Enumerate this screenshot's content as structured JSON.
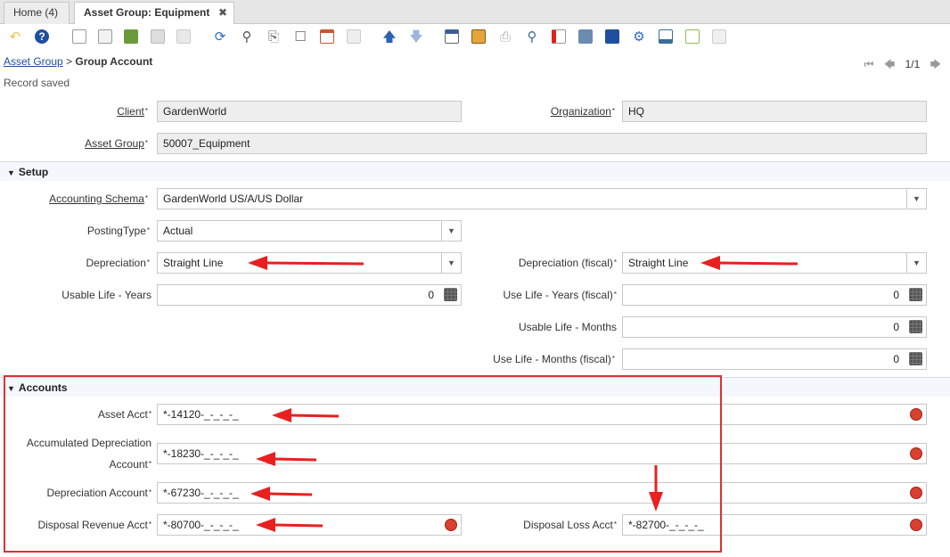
{
  "tabs": [
    {
      "label": "Home (4)"
    },
    {
      "label": "Asset Group: Equipment"
    }
  ],
  "tab_close": "✖",
  "breadcrumb": {
    "parent": "Asset Group",
    "separator": ">",
    "current": "Group Account"
  },
  "pager": {
    "count": "1/1"
  },
  "status": "Record saved",
  "header_fields": {
    "client": {
      "label": "Client",
      "value": "GardenWorld"
    },
    "organization": {
      "label": "Organization",
      "value": "HQ"
    },
    "asset_group": {
      "label": "Asset Group",
      "value": "50007_Equipment"
    }
  },
  "setup": {
    "title": "Setup",
    "accounting_schema": {
      "label": "Accounting Schema",
      "value": "GardenWorld US/A/US Dollar"
    },
    "posting_type": {
      "label": "PostingType",
      "value": "Actual"
    },
    "depreciation": {
      "label": "Depreciation",
      "value": "Straight Line"
    },
    "depreciation_fiscal": {
      "label": "Depreciation (fiscal)",
      "value": "Straight Line"
    },
    "usable_life_years": {
      "label": "Usable Life - Years",
      "value": "0"
    },
    "use_life_years_fiscal": {
      "label": "Use Life - Years (fiscal)",
      "value": "0"
    },
    "usable_life_months": {
      "label": "Usable Life - Months",
      "value": "0"
    },
    "use_life_months_fiscal": {
      "label": "Use Life - Months (fiscal)",
      "value": "0"
    }
  },
  "accounts": {
    "title": "Accounts",
    "asset_acct": {
      "label": "Asset Acct",
      "value": "*-14120-_-_-_-_"
    },
    "accum_depr_acct": {
      "label_line1": "Accumulated Depreciation",
      "label_line2": "Account",
      "value": "*-18230-_-_-_-_"
    },
    "depr_acct": {
      "label": "Depreciation Account",
      "value": "*-67230-_-_-_-_"
    },
    "disposal_revenue": {
      "label": "Disposal Revenue Acct",
      "value": "*-80700-_-_-_-_"
    },
    "disposal_loss": {
      "label": "Disposal Loss Acct",
      "value": "*-82700-_-_-_-_"
    }
  },
  "required_mark": "*",
  "colors": {
    "annotation": "#e03030",
    "link": "#1e4f9c",
    "readonly_bg": "#eeeeee"
  }
}
